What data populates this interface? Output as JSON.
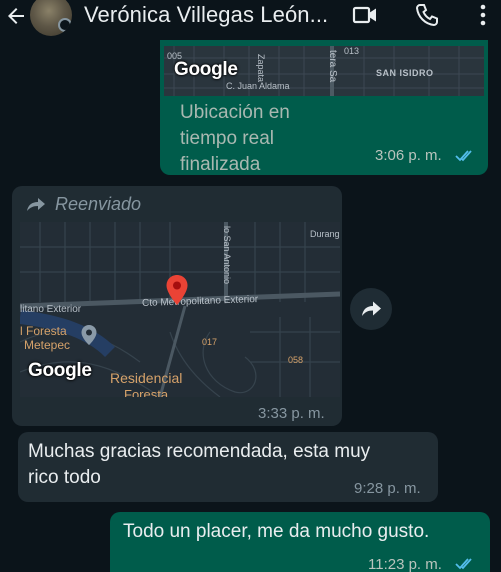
{
  "header": {
    "contact_name": "Verónica Villegas León...",
    "icons": [
      "back-arrow-icon",
      "video-call-icon",
      "phone-icon",
      "more-vertical-icon"
    ]
  },
  "messages": [
    {
      "id": "live-location",
      "direction": "outgoing",
      "map_labels": [
        "005",
        "Zapata",
        "013",
        "tera Sa",
        "San Isidro",
        "C. Juan Aldama"
      ],
      "map_logo": "Google",
      "text": "Ubicación en tiempo real finalizada",
      "time": "3:06 p. m.",
      "status": "read"
    },
    {
      "id": "forwarded-map",
      "direction": "incoming",
      "forwarded_label": "Reenviado",
      "map_labels": {
        "durango": "Durang",
        "street_vertical": "lo San Antonio",
        "street_main": "Cto Metropolitano Exterior",
        "street_left": "litano Exterior",
        "foresta": "l Foresta",
        "metepec": "Metepec",
        "num_017": "017",
        "num_058": "058",
        "residencial": "Residencial",
        "foresta_bottom": "Foresta"
      },
      "map_logo": "Google",
      "time": "3:33 p. m."
    },
    {
      "id": "thanks",
      "direction": "incoming",
      "text": "Muchas gracias recomendada, esta muy rico todo",
      "line1": "Muchas gracias recomendada, esta muy",
      "line2": "rico todo",
      "time": "9:28 p. m."
    },
    {
      "id": "reply",
      "direction": "outgoing",
      "text": "Todo un placer, me da mucho gusto.",
      "time": "11:23 p. m.",
      "status": "read"
    }
  ],
  "colors": {
    "background": "#0b141a",
    "outgoing_bubble": "#005c4b",
    "incoming_bubble": "#202c33",
    "read_ticks": "#53bdeb",
    "map_pin": "#ea4335"
  }
}
